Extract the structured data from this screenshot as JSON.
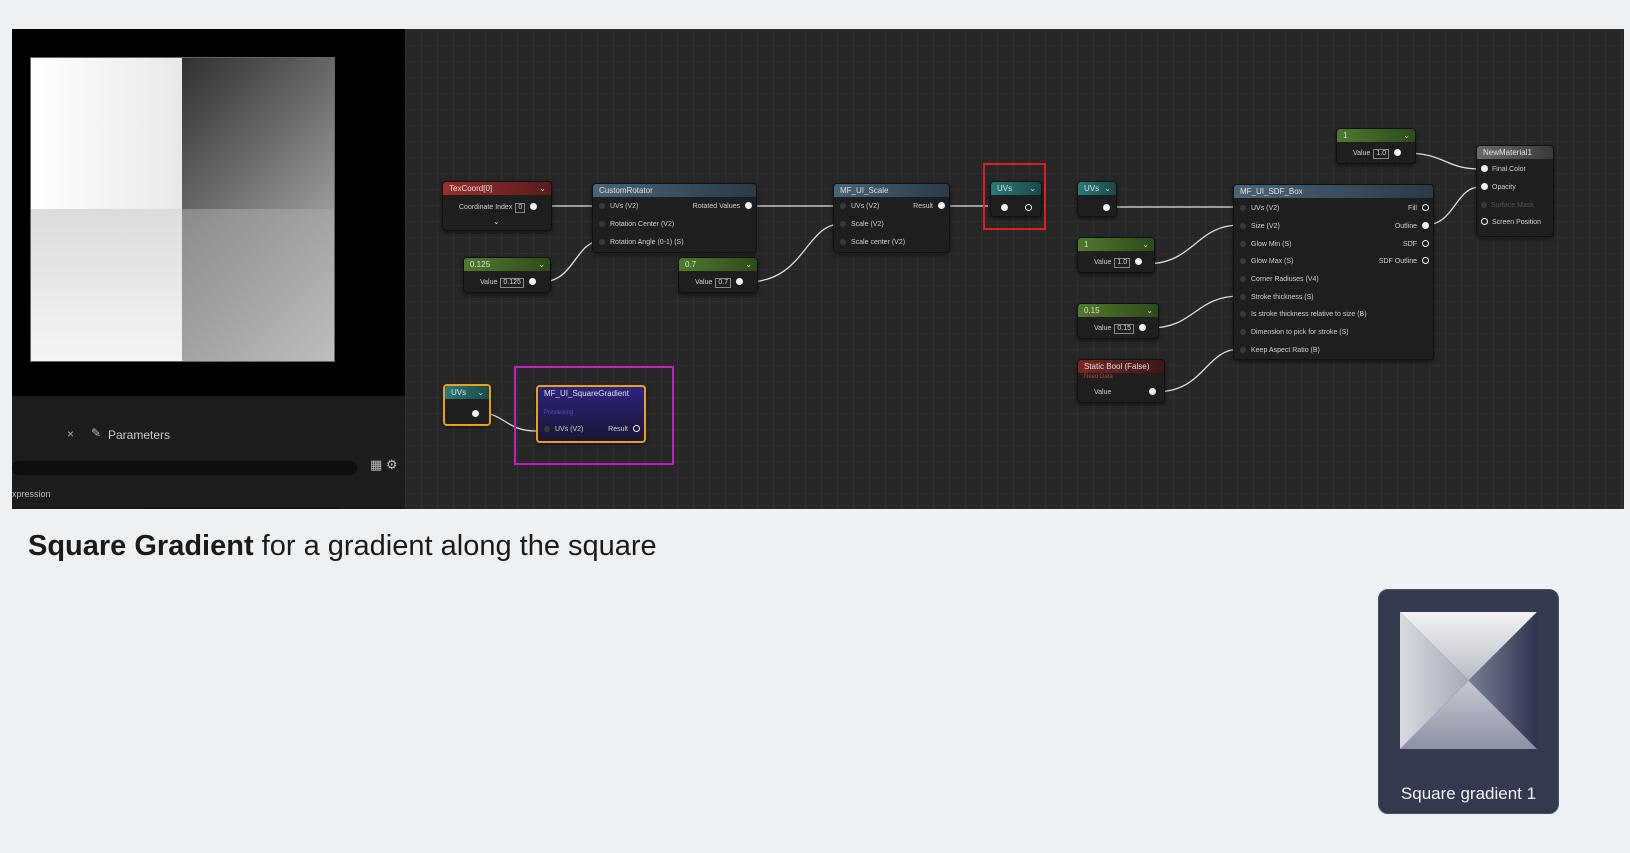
{
  "params_panel": {
    "close_glyph": "×",
    "tab_label": "Parameters",
    "expression_label": "xpression"
  },
  "colors": {
    "header_red": "#7a2424",
    "header_green": "#3c5a24",
    "header_blue": "#34495a",
    "header_teal": "#1e5252",
    "header_purple": "#2b2480",
    "highlight_red": "#e02020",
    "highlight_magenta": "#c020c0",
    "selected_border": "#e8a21a"
  },
  "nodes": {
    "texcoord": {
      "title": "TexCoord[0]",
      "param": "Coordinate Index",
      "value": "0"
    },
    "const_0125": {
      "title": "0.125",
      "param": "Value",
      "value": "0.125"
    },
    "custom_rotator": {
      "title": "CustomRotator",
      "in1": "UVs (V2)",
      "in2": "Rotation Center (V2)",
      "in3": "Rotation Angle (0-1) (S)",
      "out": "Rotated Values"
    },
    "const_07": {
      "title": "0.7",
      "param": "Value",
      "value": "0.7"
    },
    "mf_ui_scale": {
      "title": "MF_UI_Scale",
      "in1": "UVs (V2)",
      "in2": "Scale (V2)",
      "in3": "Scale center (V2)",
      "out": "Result"
    },
    "reroute_uvs1": {
      "title": "UVs"
    },
    "reroute_uvs2": {
      "title": "UVs"
    },
    "const_1": {
      "title": "1",
      "param": "Value",
      "value": "1.0"
    },
    "const_015": {
      "title": "0.15",
      "param": "Value",
      "value": "0.15"
    },
    "static_bool": {
      "title": "Static Bool (False)",
      "sub": "Need Data",
      "param": "Value"
    },
    "mf_ui_sdf_box": {
      "title": "MF_UI_SDF_Box",
      "inputs": [
        "UVs (V2)",
        "Size (V2)",
        "Glow Min (S)",
        "Glow Max (S)",
        "Corner Radiuses (V4)",
        "Stroke thickness (S)",
        "Is stroke thickness relative to size (B)",
        "Dimension to pick for stroke (S)",
        "Keep Aspect Ratio (B)"
      ],
      "outputs": [
        "Fill",
        "Outline",
        "SDF",
        "SDF Outline"
      ]
    },
    "const_top": {
      "title": "1",
      "param": "Value",
      "value": "1.0"
    },
    "new_material": {
      "title": "NewMaterial1",
      "in1": "Final Color",
      "in2": "Opacity",
      "in3": "Surface Mask",
      "in4": "Screen Position"
    },
    "uvs_small": {
      "title": "UVs"
    },
    "square_gradient": {
      "title": "MF_UI_SquareGradient",
      "sub": "Previewing",
      "in1": "UVs (V2)",
      "out": "Result"
    }
  },
  "caption": {
    "bold": "Square Gradient",
    "rest": " for a gradient along the square"
  },
  "thumbnail": {
    "label": "Square gradient 1"
  }
}
